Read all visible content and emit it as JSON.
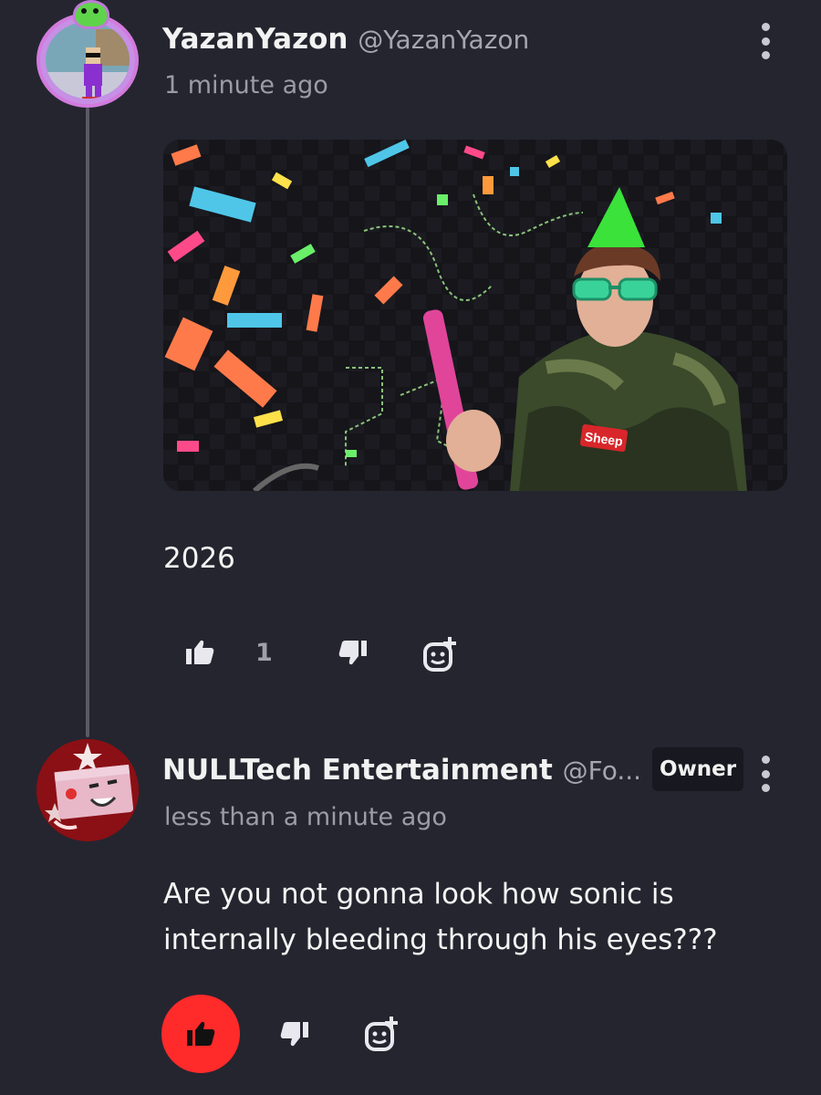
{
  "comments": [
    {
      "username": "YazanYazon",
      "handle": "@YazanYazon",
      "time": "1 minute ago",
      "text": "2026",
      "like_count": "1",
      "image_label": "Sheep"
    },
    {
      "username": "NULLTech Entertainment",
      "handle": "@Fo...",
      "badge": "Owner",
      "time": "less than a minute ago",
      "text_line1": "Are you not gonna look how sonic is",
      "text_line2": "internally bleeding through his eyes???"
    }
  ],
  "colors": {
    "background": "#25252f",
    "like_active": "#ff2a2a",
    "muted_text": "#9c9ca6"
  },
  "icons": [
    "thumbs-up-icon",
    "thumbs-down-icon",
    "add-reaction-icon",
    "more-options-icon"
  ]
}
